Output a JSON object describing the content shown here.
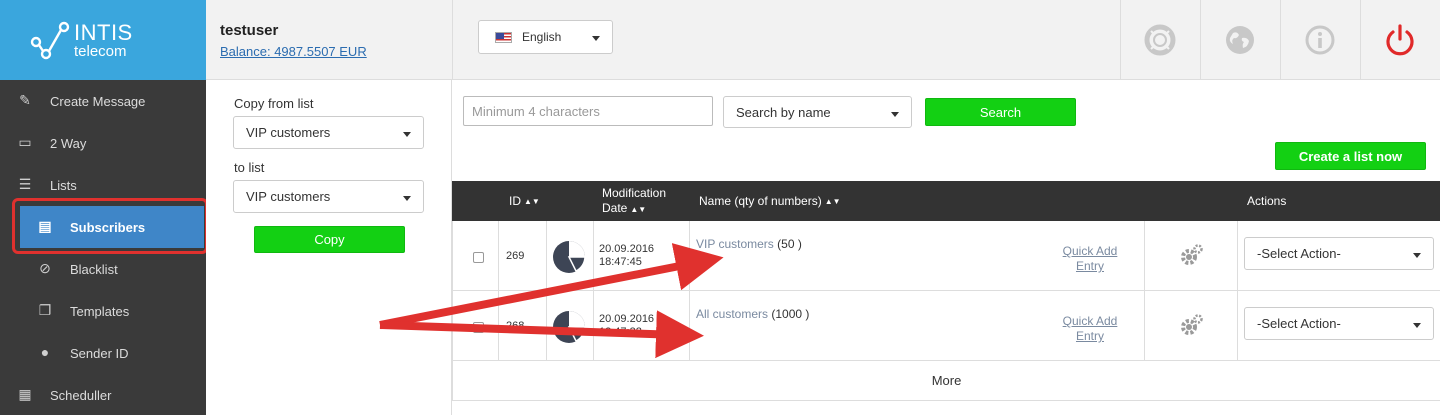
{
  "logo": {
    "line1": "INTIS",
    "line2": "telecom"
  },
  "user": {
    "name": "testuser",
    "balance": "Balance: 4987.5507 EUR"
  },
  "language": {
    "selected": "English"
  },
  "sidebar": {
    "items": [
      {
        "label": "Create Message",
        "icon": "pencil-icon"
      },
      {
        "label": "2 Way",
        "icon": "inbox-icon"
      },
      {
        "label": "Lists",
        "icon": "list-icon"
      },
      {
        "label": "Subscribers",
        "icon": "book-icon"
      },
      {
        "label": "Blacklist",
        "icon": "ban-icon"
      },
      {
        "label": "Templates",
        "icon": "copy-icon"
      },
      {
        "label": "Sender ID",
        "icon": "user-icon"
      },
      {
        "label": "Scheduller",
        "icon": "calendar-icon"
      }
    ]
  },
  "copy_panel": {
    "from_label": "Copy from list",
    "from_value": "VIP customers",
    "to_label": "to list",
    "to_value": "VIP customers",
    "button": "Copy"
  },
  "search": {
    "placeholder": "Minimum 4 characters",
    "mode": "Search by name",
    "button": "Search"
  },
  "create_button": "Create a list now",
  "table": {
    "headers": {
      "id": "ID",
      "mod_line1": "Modification",
      "mod_line2": "Date",
      "name": "Name (qty of numbers)",
      "actions": "Actions"
    },
    "rows": [
      {
        "id": "269",
        "date": "20.09.2016",
        "time": "18:47:45",
        "name": "VIP customers",
        "qty": "(50 )",
        "quick_add_1": "Quick Add",
        "quick_add_2": "Entry",
        "action": "-Select Action-"
      },
      {
        "id": "268",
        "date": "20.09.2016",
        "time": "18:47:32",
        "name": "All customers",
        "qty": "(1000 )",
        "quick_add_1": "Quick Add",
        "quick_add_2": "Entry",
        "action": "-Select Action-"
      }
    ],
    "more": "More"
  },
  "colors": {
    "brand": "#3aa6dd",
    "sidebar": "#3a3a3a",
    "active": "#3f86c8",
    "green": "#13d013",
    "highlight": "#e0312e"
  }
}
